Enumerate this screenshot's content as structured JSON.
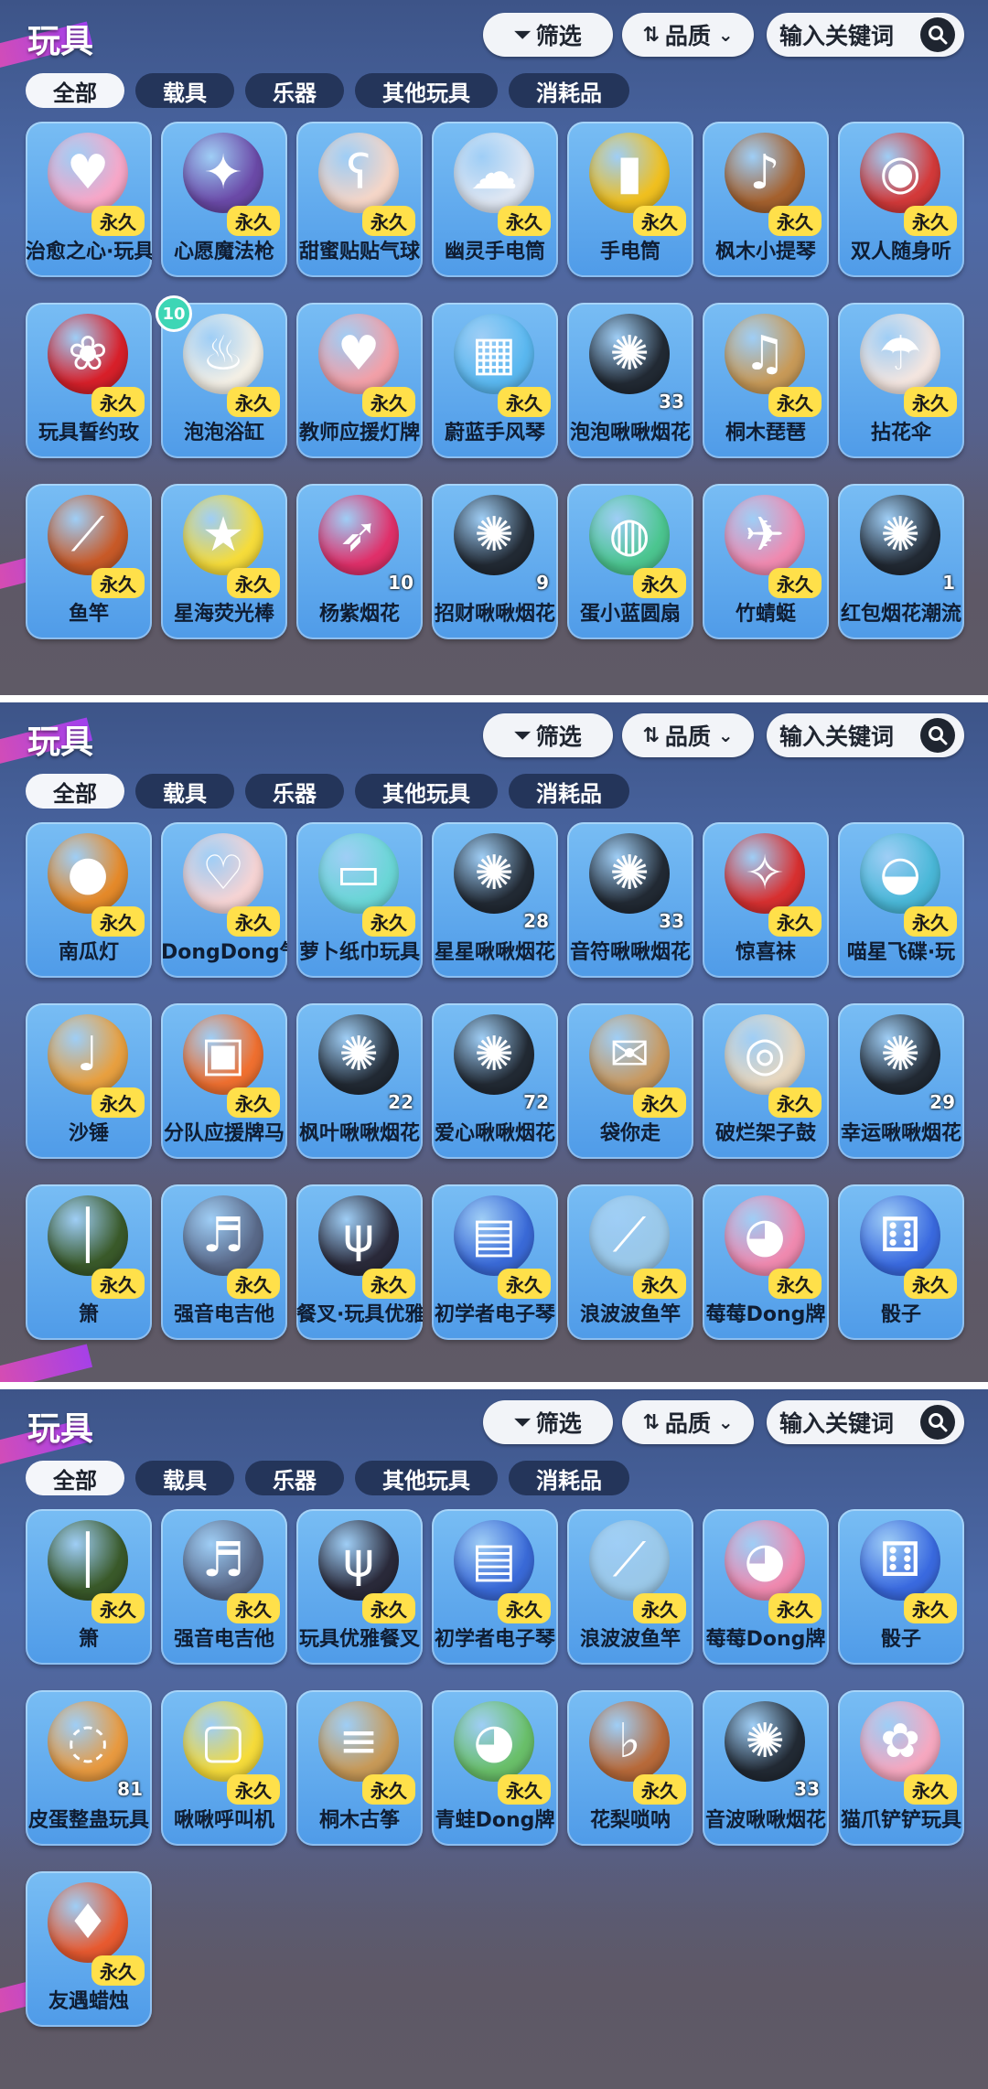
{
  "panels": [
    {
      "title": "玩具",
      "filter": "筛选",
      "sort": "品质",
      "search_placeholder": "输入关键词",
      "tabs": [
        "全部",
        "载具",
        "乐器",
        "其他玩具",
        "消耗品"
      ],
      "items": [
        {
          "name": "治愈之心·玩具",
          "badge": "永久",
          "icon": "heart-wings-icon",
          "color": "#f7a7c8"
        },
        {
          "name": "心愿魔法枪",
          "badge": "永久",
          "icon": "magic-gun-icon",
          "color": "#6b4aa8"
        },
        {
          "name": "甜蜜贴贴气球",
          "badge": "永久",
          "icon": "bear-balloon-icon",
          "color": "#f5d6c8"
        },
        {
          "name": "幽灵手电筒",
          "badge": "永久",
          "icon": "ghost-flashlight-icon",
          "color": "#dfe7f3"
        },
        {
          "name": "手电筒",
          "badge": "永久",
          "icon": "flashlight-icon",
          "color": "#f0c020"
        },
        {
          "name": "枫木小提琴",
          "badge": "永久",
          "icon": "violin-icon",
          "color": "#a5612e"
        },
        {
          "name": "双人随身听",
          "badge": "永久",
          "icon": "record-player-icon",
          "color": "#d43a3a"
        },
        {
          "name": "玩具誓约玫",
          "badge": "永久",
          "icon": "rose-icon",
          "color": "#d8202a",
          "corner": ""
        },
        {
          "name": "泡泡浴缸",
          "badge": "永久",
          "icon": "bathtub-icon",
          "color": "#f4f0e6",
          "corner": "10"
        },
        {
          "name": "教师应援灯牌",
          "badge": "永久",
          "icon": "heart-sign-icon",
          "color": "#f2a0a8"
        },
        {
          "name": "蔚蓝手风琴",
          "badge": "永久",
          "icon": "accordion-icon",
          "color": "#5ab8f0"
        },
        {
          "name": "泡泡啾啾烟花",
          "count": "33",
          "icon": "firework-icon",
          "color": "#222a34"
        },
        {
          "name": "桐木琵琶",
          "badge": "永久",
          "icon": "pipa-icon",
          "color": "#c89a58"
        },
        {
          "name": "拈花伞",
          "badge": "永久",
          "icon": "umbrella-icon",
          "color": "#f4e6e0"
        },
        {
          "name": "鱼竿",
          "badge": "永久",
          "icon": "fishing-rod-icon",
          "color": "#c85a28"
        },
        {
          "name": "星海荧光棒",
          "badge": "永久",
          "icon": "star-wand-icon",
          "color": "#f6dc3a"
        },
        {
          "name": "杨紫烟花",
          "count": "10",
          "icon": "rocket-icon",
          "color": "#e0306a"
        },
        {
          "name": "招财啾啾烟花",
          "count": "9",
          "icon": "firework-icon",
          "color": "#222a34"
        },
        {
          "name": "蛋小蓝圆扇",
          "badge": "永久",
          "icon": "round-fan-icon",
          "color": "#4cc690"
        },
        {
          "name": "竹蜻蜓",
          "badge": "永久",
          "icon": "bamboo-copter-icon",
          "color": "#f08ab0"
        },
        {
          "name": "红包烟花潮流",
          "count": "1",
          "icon": "firework-icon",
          "color": "#222a34"
        }
      ]
    },
    {
      "title": "玩具",
      "filter": "筛选",
      "sort": "品质",
      "search_placeholder": "输入关键词",
      "tabs": [
        "全部",
        "载具",
        "乐器",
        "其他玩具",
        "消耗品"
      ],
      "items": [
        {
          "name": "南瓜灯",
          "badge": "永久",
          "icon": "pumpkin-lantern-icon",
          "color": "#e58a2a"
        },
        {
          "name": "DongDong气球",
          "badge": "永久",
          "icon": "cake-balloon-icon",
          "color": "#f6d4d4"
        },
        {
          "name": "萝卜纸巾玩具",
          "badge": "永久",
          "icon": "tissue-box-icon",
          "color": "#6ad6d6"
        },
        {
          "name": "星星啾啾烟花",
          "count": "28",
          "icon": "firework-icon",
          "color": "#222a34"
        },
        {
          "name": "音符啾啾烟花",
          "count": "33",
          "icon": "firework-icon",
          "color": "#222a34"
        },
        {
          "name": "惊喜袜",
          "badge": "永久",
          "icon": "stocking-icon",
          "color": "#d83030"
        },
        {
          "name": "喵星飞碟·玩",
          "badge": "永久",
          "icon": "ufo-icon",
          "color": "#4ab8d8"
        },
        {
          "name": "沙锤",
          "badge": "永久",
          "icon": "maracas-icon",
          "color": "#e8a040"
        },
        {
          "name": "分队应援牌马",
          "badge": "永久",
          "icon": "cheer-sign-icon",
          "color": "#f07030"
        },
        {
          "name": "枫叶啾啾烟花",
          "count": "22",
          "icon": "firework-icon",
          "color": "#222a34"
        },
        {
          "name": "爱心啾啾烟花",
          "count": "72",
          "icon": "firework-icon",
          "color": "#222a34"
        },
        {
          "name": "袋你走",
          "badge": "永久",
          "icon": "takeaway-bag-icon",
          "color": "#c89a62"
        },
        {
          "name": "破烂架子鼓",
          "badge": "永久",
          "icon": "drum-kit-icon",
          "color": "#e8d8c0"
        },
        {
          "name": "幸运啾啾烟花",
          "count": "29",
          "icon": "firework-icon",
          "color": "#222a34"
        },
        {
          "name": "箫",
          "badge": "永久",
          "icon": "flute-icon",
          "color": "#3a5a2a"
        },
        {
          "name": "强音电吉他",
          "badge": "永久",
          "icon": "electric-guitar-icon",
          "color": "#5a6a8a"
        },
        {
          "name": "餐叉·玩具优雅",
          "badge": "永久",
          "icon": "fork-icon",
          "color": "#2a2a3a"
        },
        {
          "name": "初学者电子琴",
          "badge": "永久",
          "icon": "keytar-icon",
          "color": "#3a6ad8"
        },
        {
          "name": "浪波波鱼竿",
          "badge": "永久",
          "icon": "fishing-rod-icon",
          "color": "#9ac8e8"
        },
        {
          "name": "莓莓Dong牌",
          "badge": "永久",
          "icon": "dong-sign-icon",
          "color": "#f08ab0"
        },
        {
          "name": "骰子",
          "badge": "永久",
          "icon": "dice-icon",
          "color": "#3a6ae0"
        }
      ]
    },
    {
      "title": "玩具",
      "filter": "筛选",
      "sort": "品质",
      "search_placeholder": "输入关键词",
      "tabs": [
        "全部",
        "载具",
        "乐器",
        "其他玩具",
        "消耗品"
      ],
      "items": [
        {
          "name": "箫",
          "badge": "永久",
          "icon": "flute-icon",
          "color": "#3a5a2a"
        },
        {
          "name": "强音电吉他",
          "badge": "永久",
          "icon": "electric-guitar-icon",
          "color": "#5a6a8a"
        },
        {
          "name": "玩具优雅餐叉",
          "badge": "永久",
          "icon": "fork-icon",
          "color": "#2a2a3a"
        },
        {
          "name": "初学者电子琴",
          "badge": "永久",
          "icon": "keytar-icon",
          "color": "#3a6ad8"
        },
        {
          "name": "浪波波鱼竿",
          "badge": "永久",
          "icon": "fishing-rod-icon",
          "color": "#9ac8e8"
        },
        {
          "name": "莓莓Dong牌",
          "badge": "永久",
          "icon": "dong-sign-icon",
          "color": "#f08ab0"
        },
        {
          "name": "骰子",
          "badge": "永久",
          "icon": "dice-icon",
          "color": "#3a6ae0"
        },
        {
          "name": "皮蛋整蛊玩具",
          "count": "81",
          "icon": "prank-horn-icon",
          "color": "#e89a40"
        },
        {
          "name": "啾啾呼叫机",
          "badge": "永久",
          "icon": "pager-icon",
          "color": "#f6dc3a"
        },
        {
          "name": "桐木古筝",
          "badge": "永久",
          "icon": "guzheng-icon",
          "color": "#c89a58"
        },
        {
          "name": "青蛙Dong牌",
          "badge": "永久",
          "icon": "dong-sign-icon",
          "color": "#6ac06a"
        },
        {
          "name": "花梨唢呐",
          "badge": "永久",
          "icon": "suona-icon",
          "color": "#b86a3a"
        },
        {
          "name": "音波啾啾烟花",
          "count": "33",
          "icon": "firework-icon",
          "color": "#222a34"
        },
        {
          "name": "猫爪铲铲玩具",
          "badge": "永久",
          "icon": "cat-paw-icon",
          "color": "#f6a8c0"
        },
        {
          "name": "友遇蜡烛",
          "badge": "永久",
          "icon": "candle-icon",
          "color": "#e85a30"
        }
      ]
    }
  ]
}
